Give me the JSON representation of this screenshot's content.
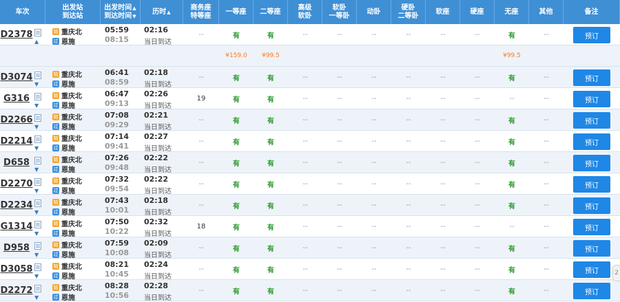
{
  "header": {
    "train": [
      "车次"
    ],
    "stations": [
      "出发站",
      "到达站"
    ],
    "times": [
      "出发时间",
      "到达时间"
    ],
    "duration": [
      "历时"
    ],
    "business": [
      "商务座",
      "特等座"
    ],
    "first": [
      "一等座"
    ],
    "second": [
      "二等座"
    ],
    "advsoft": [
      "高级",
      "软卧"
    ],
    "softsleep": [
      "软卧",
      "一等卧"
    ],
    "dongwo": [
      "动卧"
    ],
    "hardsleep": [
      "硬卧",
      "二等卧"
    ],
    "softseat": [
      "软座"
    ],
    "hardseat": [
      "硬座"
    ],
    "noseat": [
      "无座"
    ],
    "other": [
      "其他"
    ],
    "remark": [
      "备注"
    ],
    "sort_asc": "▲",
    "sort_desc": "▼"
  },
  "from_badge": "始",
  "to_badge": "过",
  "expanded_icon": "▲",
  "collapsed_icon": "▼",
  "book_label": "预订",
  "same_day_label": "当日到达",
  "scroll_hint": "2",
  "trains": [
    {
      "no": "D2378",
      "from": "重庆北",
      "to": "恩施",
      "dep": "05:59",
      "arr": "08:15",
      "dur": "02:16",
      "seats": [
        "--",
        "有",
        "有",
        "--",
        "--",
        "--",
        "--",
        "--",
        "--",
        "有",
        "--"
      ],
      "expanded": true,
      "prices": [
        "",
        "¥159.0",
        "¥99.5",
        "",
        "",
        "",
        "",
        "",
        "",
        "¥99.5",
        ""
      ]
    },
    {
      "no": "D3074",
      "from": "重庆北",
      "to": "恩施",
      "dep": "06:41",
      "arr": "08:59",
      "dur": "02:18",
      "seats": [
        "--",
        "有",
        "有",
        "--",
        "--",
        "--",
        "--",
        "--",
        "--",
        "有",
        "--"
      ]
    },
    {
      "no": "G316",
      "from": "重庆北",
      "to": "恩施",
      "dep": "06:47",
      "arr": "09:13",
      "dur": "02:26",
      "seats": [
        "19",
        "有",
        "有",
        "--",
        "--",
        "--",
        "--",
        "--",
        "--",
        "--",
        "--"
      ]
    },
    {
      "no": "D2266",
      "from": "重庆北",
      "to": "恩施",
      "dep": "07:08",
      "arr": "09:29",
      "dur": "02:21",
      "seats": [
        "--",
        "有",
        "有",
        "--",
        "--",
        "--",
        "--",
        "--",
        "--",
        "有",
        "--"
      ]
    },
    {
      "no": "D2214",
      "from": "重庆北",
      "to": "恩施",
      "dep": "07:14",
      "arr": "09:41",
      "dur": "02:27",
      "seats": [
        "--",
        "有",
        "有",
        "--",
        "--",
        "--",
        "--",
        "--",
        "--",
        "有",
        "--"
      ]
    },
    {
      "no": "D658",
      "from": "重庆北",
      "to": "恩施",
      "dep": "07:26",
      "arr": "09:48",
      "dur": "02:22",
      "seats": [
        "--",
        "有",
        "有",
        "--",
        "--",
        "--",
        "--",
        "--",
        "--",
        "有",
        "--"
      ]
    },
    {
      "no": "D2270",
      "from": "重庆北",
      "to": "恩施",
      "dep": "07:32",
      "arr": "09:54",
      "dur": "02:22",
      "seats": [
        "--",
        "有",
        "有",
        "--",
        "--",
        "--",
        "--",
        "--",
        "--",
        "有",
        "--"
      ]
    },
    {
      "no": "D2234",
      "from": "重庆北",
      "to": "恩施",
      "dep": "07:43",
      "arr": "10:01",
      "dur": "02:18",
      "seats": [
        "--",
        "有",
        "有",
        "--",
        "--",
        "--",
        "--",
        "--",
        "--",
        "有",
        "--"
      ],
      "flag": true
    },
    {
      "no": "G1314",
      "from": "重庆北",
      "to": "恩施",
      "dep": "07:50",
      "arr": "10:22",
      "dur": "02:32",
      "seats": [
        "18",
        "有",
        "有",
        "--",
        "--",
        "--",
        "--",
        "--",
        "--",
        "--",
        "--"
      ]
    },
    {
      "no": "D958",
      "from": "重庆北",
      "to": "恩施",
      "dep": "07:59",
      "arr": "10:08",
      "dur": "02:09",
      "seats": [
        "--",
        "有",
        "有",
        "--",
        "--",
        "--",
        "--",
        "--",
        "--",
        "有",
        "--"
      ]
    },
    {
      "no": "D3058",
      "from": "重庆北",
      "to": "恩施",
      "dep": "08:21",
      "arr": "10:45",
      "dur": "02:24",
      "seats": [
        "--",
        "有",
        "有",
        "--",
        "--",
        "--",
        "--",
        "--",
        "--",
        "有",
        "--"
      ]
    },
    {
      "no": "D2272",
      "from": "重庆北",
      "to": "恩施",
      "dep": "08:28",
      "arr": "10:56",
      "dur": "02:28",
      "seats": [
        "--",
        "有",
        "有",
        "--",
        "--",
        "--",
        "--",
        "--",
        "--",
        "有",
        "--"
      ]
    }
  ]
}
